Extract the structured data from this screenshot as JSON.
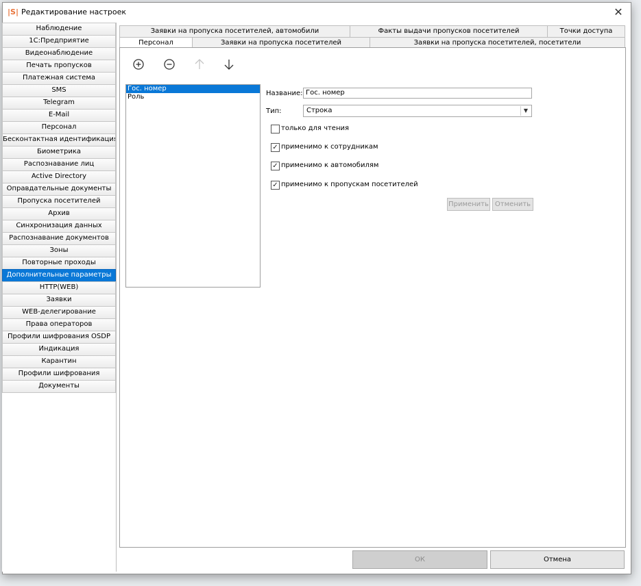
{
  "window": {
    "logo": "|S|",
    "title": "Редактирование настроек",
    "close": "✕"
  },
  "sidebar": {
    "items": [
      "Наблюдение",
      "1С:Предприятие",
      "Видеонаблюдение",
      "Печать пропусков",
      "Платежная система",
      "SMS",
      "Telegram",
      "E-Mail",
      "Персонал",
      "Бесконтактная идентификация",
      "Биометрика",
      "Распознавание лиц",
      "Active Directory",
      "Оправдательные документы",
      "Пропуска посетителей",
      "Архив",
      "Синхронизация данных",
      "Распознавание документов",
      "Зоны",
      "Повторные проходы",
      "Дополнительные параметры",
      "HTTP(WEB)",
      "Заявки",
      "WEB-делегирование",
      "Права операторов",
      "Профили шифрования OSDP",
      "Индикация",
      "Карантин",
      "Профили шифрования",
      "Документы"
    ],
    "active": "Дополнительные параметры"
  },
  "tabs": {
    "row1": [
      "Заявки на пропуска посетителей, автомобили",
      "Факты выдачи пропусков посетителей",
      "Точки доступа"
    ],
    "row2": [
      "Персонал",
      "Заявки на пропуска посетителей",
      "Заявки на пропуска посетителей, посетители"
    ],
    "active": "Персонал"
  },
  "toolbar": {
    "add_icon": "add-circle-icon",
    "remove_icon": "remove-circle-icon",
    "up_icon": "arrow-up-icon",
    "down_icon": "arrow-down-icon"
  },
  "fields": {
    "items": [
      "Гос. номер",
      "Роль"
    ],
    "selected": "Гос. номер"
  },
  "form": {
    "name_label": "Название:",
    "name_value": "Гос. номер",
    "type_label": "Тип:",
    "type_value": "Строка",
    "readonly_label": "только для чтения",
    "readonly_checked": false,
    "employees_label": "применимо к сотрудникам",
    "employees_checked": true,
    "cars_label": "применимо к автомобилям",
    "cars_checked": true,
    "visitors_label": "применимо к пропускам посетителей",
    "visitors_checked": true,
    "apply_label": "Применить",
    "revert_label": "Отменить"
  },
  "footer": {
    "ok_label": "ОК",
    "cancel_label": "Отмена"
  },
  "colors": {
    "accent": "#0a78d7",
    "logo": "#e8743b"
  }
}
